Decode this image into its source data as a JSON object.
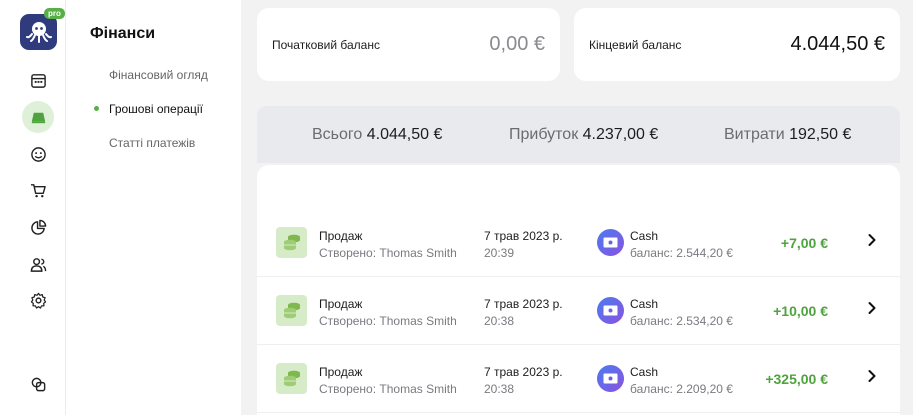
{
  "app": {
    "pro_badge": "pro"
  },
  "sidebar": {
    "title": "Фінанси",
    "items": [
      {
        "label": "Фінансовий огляд",
        "active": false
      },
      {
        "label": "Грошові операції",
        "active": true
      },
      {
        "label": "Статті платежів",
        "active": false
      }
    ]
  },
  "rail": {
    "icons": [
      "calendar-icon",
      "cash-register-icon",
      "smile-icon",
      "cart-icon",
      "pie-chart-icon",
      "users-icon",
      "settings-icon",
      "overlap-icon"
    ],
    "active": "cash-register-icon"
  },
  "balances": {
    "start_label": "Початковий баланс",
    "start_value": "0,00 €",
    "end_label": "Кінцевий баланс",
    "end_value": "4.044,50 €"
  },
  "totals": {
    "total_label": "Всього",
    "total_value": "4.044,50 €",
    "income_label": "Прибуток",
    "income_value": "4.237,00 €",
    "expense_label": "Витрати",
    "expense_value": "192,50 €"
  },
  "operations": [
    {
      "type": "Продаж",
      "created": "Створено: Thomas Smith",
      "date": "7 трав 2023 р.",
      "time": "20:39",
      "account": "Cash",
      "balance": "баланс: 2.544,20 €",
      "amount": "+7,00 €"
    },
    {
      "type": "Продаж",
      "created": "Створено: Thomas Smith",
      "date": "7 трав 2023 р.",
      "time": "20:38",
      "account": "Cash",
      "balance": "баланс: 2.534,20 €",
      "amount": "+10,00 €"
    },
    {
      "type": "Продаж",
      "created": "Створено: Thomas Smith",
      "date": "7 трав 2023 р.",
      "time": "20:38",
      "account": "Cash",
      "balance": "баланс: 2.209,20 €",
      "amount": "+325,00 €"
    }
  ],
  "colors": {
    "accent": "#56b046",
    "amount_positive": "#4ea33e",
    "brand": "#2f3b7d"
  }
}
